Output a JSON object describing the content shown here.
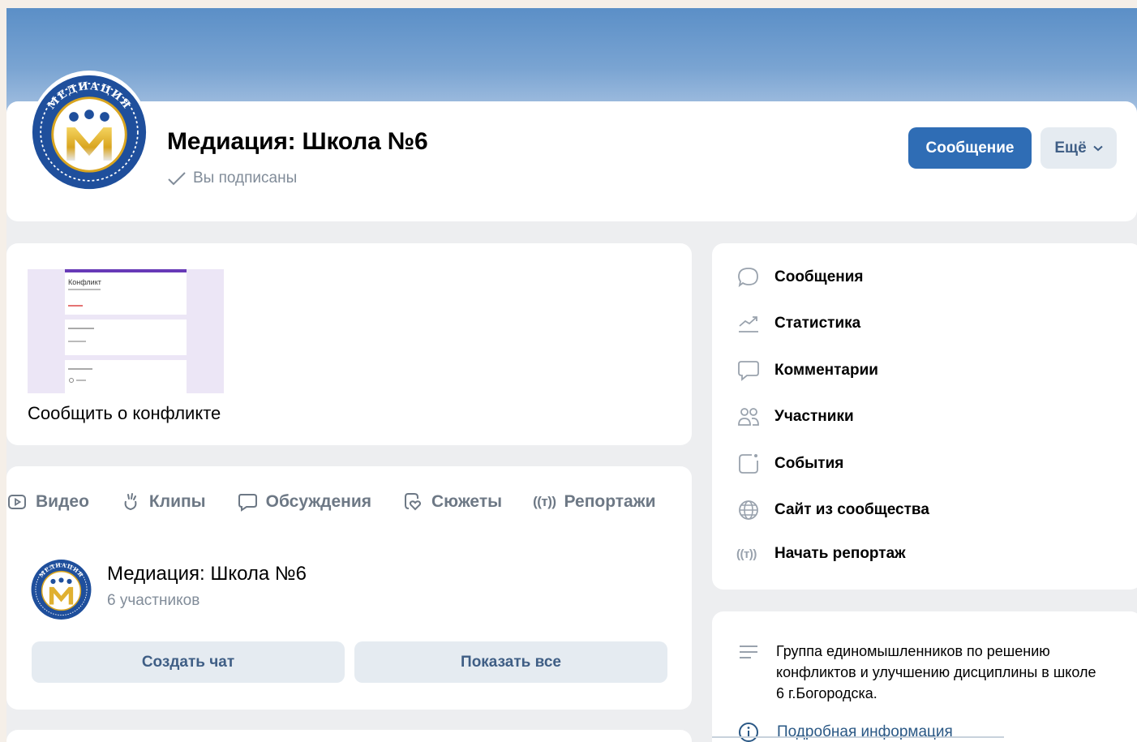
{
  "group": {
    "name": "Медиация: Школа №6",
    "subscribed_label": "Вы подписаны",
    "logo_text": "МЕДИАЦИЯ"
  },
  "actions": {
    "message_label": "Сообщение",
    "more_label": "Ещё"
  },
  "report": {
    "thumb_title": "Конфликт",
    "caption": "Сообщить о конфликте"
  },
  "tabs": [
    {
      "label": "Видео",
      "icon": "video-icon"
    },
    {
      "label": "Клипы",
      "icon": "clips-icon"
    },
    {
      "label": "Обсуждения",
      "icon": "discussions-icon"
    },
    {
      "label": "Сюжеты",
      "icon": "stories-icon"
    },
    {
      "label": "Репортажи",
      "icon": "broadcast-icon",
      "icon_text": "((т))"
    }
  ],
  "chat": {
    "title": "Медиация: Школа №6",
    "members": "6 участников",
    "create_label": "Создать чат",
    "show_all_label": "Показать все"
  },
  "menu": [
    {
      "label": "Сообщения",
      "icon": "messages-icon"
    },
    {
      "label": "Статистика",
      "icon": "statistics-icon"
    },
    {
      "label": "Комментарии",
      "icon": "comments-icon"
    },
    {
      "label": "Участники",
      "icon": "members-icon"
    },
    {
      "label": "События",
      "icon": "events-icon"
    },
    {
      "label": "Сайт из сообщества",
      "icon": "globe-icon"
    },
    {
      "label": "Начать репортаж",
      "icon": "broadcast-icon",
      "icon_text": "((т))"
    }
  ],
  "about": {
    "description": "Группа единомышленников по решению конфликтов и улучшению дисциплины в школе 6 г.Богородска.",
    "more_info_label": "Подробная информация"
  },
  "colors": {
    "accent": "#2f6db5",
    "secondary_button_bg": "#e5ebf1",
    "secondary_text": "#818c99",
    "cover_top": "#5b8fc7",
    "link": "#2a5885"
  }
}
